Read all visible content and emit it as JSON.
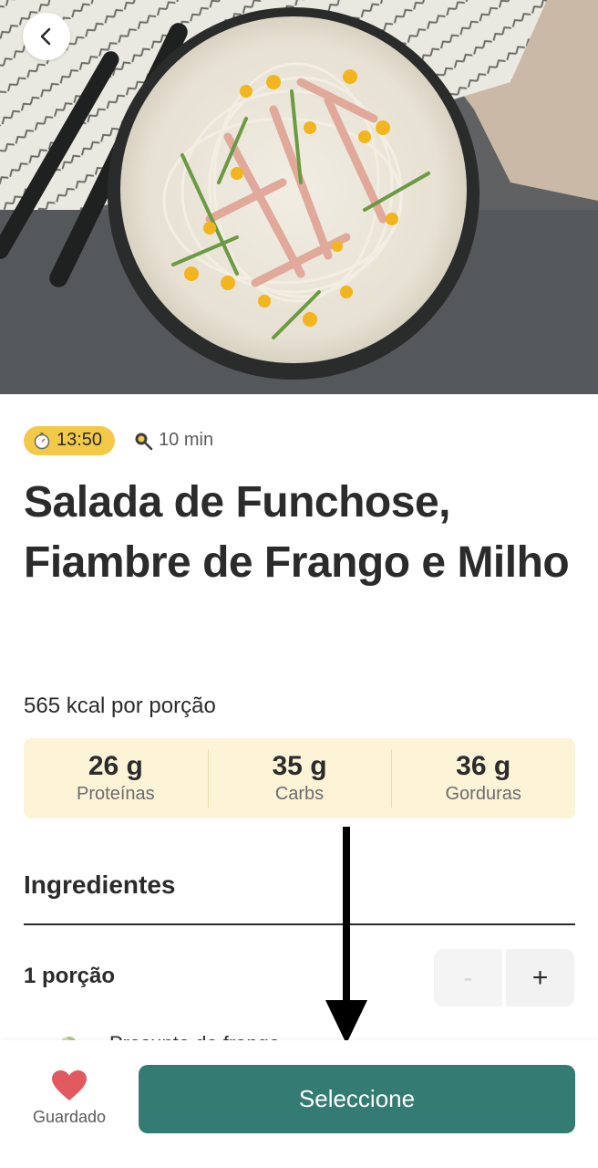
{
  "hero": {
    "image_name": "recipe-photo"
  },
  "recipe": {
    "ready_time": "13:50",
    "prep_time": "10 min",
    "title": "Salada de Funchose, Fiambre de Frango e Milho",
    "kcal": "565 kcal por porção",
    "macros": [
      {
        "value": "26 g",
        "label": "Proteínas"
      },
      {
        "value": "35 g",
        "label": "Carbs"
      },
      {
        "value": "36 g",
        "label": "Gorduras"
      }
    ]
  },
  "ingredients": {
    "title": "Ingredientes",
    "portion": "1 porção",
    "minus": "-",
    "plus": "+",
    "items": [
      {
        "name": "Presunto de frango"
      }
    ]
  },
  "bottom": {
    "saved_label": "Guardado",
    "select_label": "Seleccione"
  },
  "colors": {
    "accent": "#347c73",
    "badge": "#f3c94a",
    "macro_bg": "#fdf4d8",
    "heart": "#e05a5f"
  }
}
